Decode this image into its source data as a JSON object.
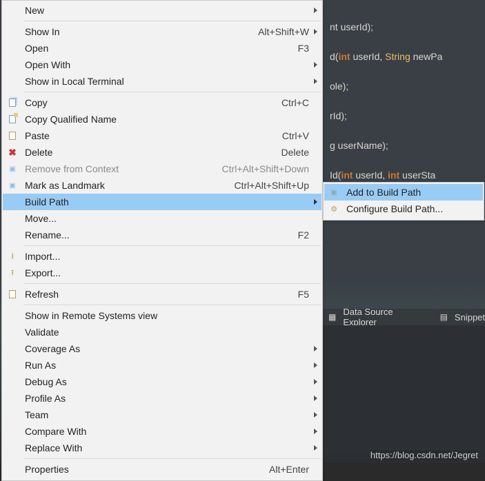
{
  "editor": {
    "line1": "nt userId);",
    "line3_a": "d(",
    "line3_int": "int",
    "line3_b": " userId, ",
    "line3_str": "String",
    "line3_c": " newPa",
    "line5": "ole);",
    "line7": "rId);",
    "line9_a": "g userName);",
    "line11_a": "Id(",
    "line11_int1": "int",
    "line11_b": " userId, ",
    "line11_int2": "int",
    "line11_c": " userSta",
    "line13cut": ""
  },
  "menu": {
    "new": "New",
    "showIn": "Show In",
    "showIn_sc": "Alt+Shift+W",
    "open": "Open",
    "open_sc": "F3",
    "openWith": "Open With",
    "showLocal": "Show in Local Terminal",
    "copy": "Copy",
    "copy_sc": "Ctrl+C",
    "copyQual": "Copy Qualified Name",
    "paste": "Paste",
    "paste_sc": "Ctrl+V",
    "delete": "Delete",
    "delete_sc": "Delete",
    "removeCtx": "Remove from Context",
    "removeCtx_sc": "Ctrl+Alt+Shift+Down",
    "markLandmark": "Mark as Landmark",
    "markLandmark_sc": "Ctrl+Alt+Shift+Up",
    "buildPath": "Build Path",
    "move": "Move...",
    "rename": "Rename...",
    "rename_sc": "F2",
    "import": "Import...",
    "export": "Export...",
    "refresh": "Refresh",
    "refresh_sc": "F5",
    "showRemote": "Show in Remote Systems view",
    "validate": "Validate",
    "coverage": "Coverage As",
    "runAs": "Run As",
    "debugAs": "Debug As",
    "profileAs": "Profile As",
    "team": "Team",
    "compare": "Compare With",
    "replace": "Replace With",
    "properties": "Properties",
    "properties_sc": "Alt+Enter"
  },
  "submenu": {
    "addToBuild": "Add to Build Path",
    "configure": "Configure Build Path..."
  },
  "tabs": {
    "dataSource": "Data Source Explorer",
    "snippets": "Snippet"
  },
  "watermark": "https://blog.csdn.net/Jegret"
}
